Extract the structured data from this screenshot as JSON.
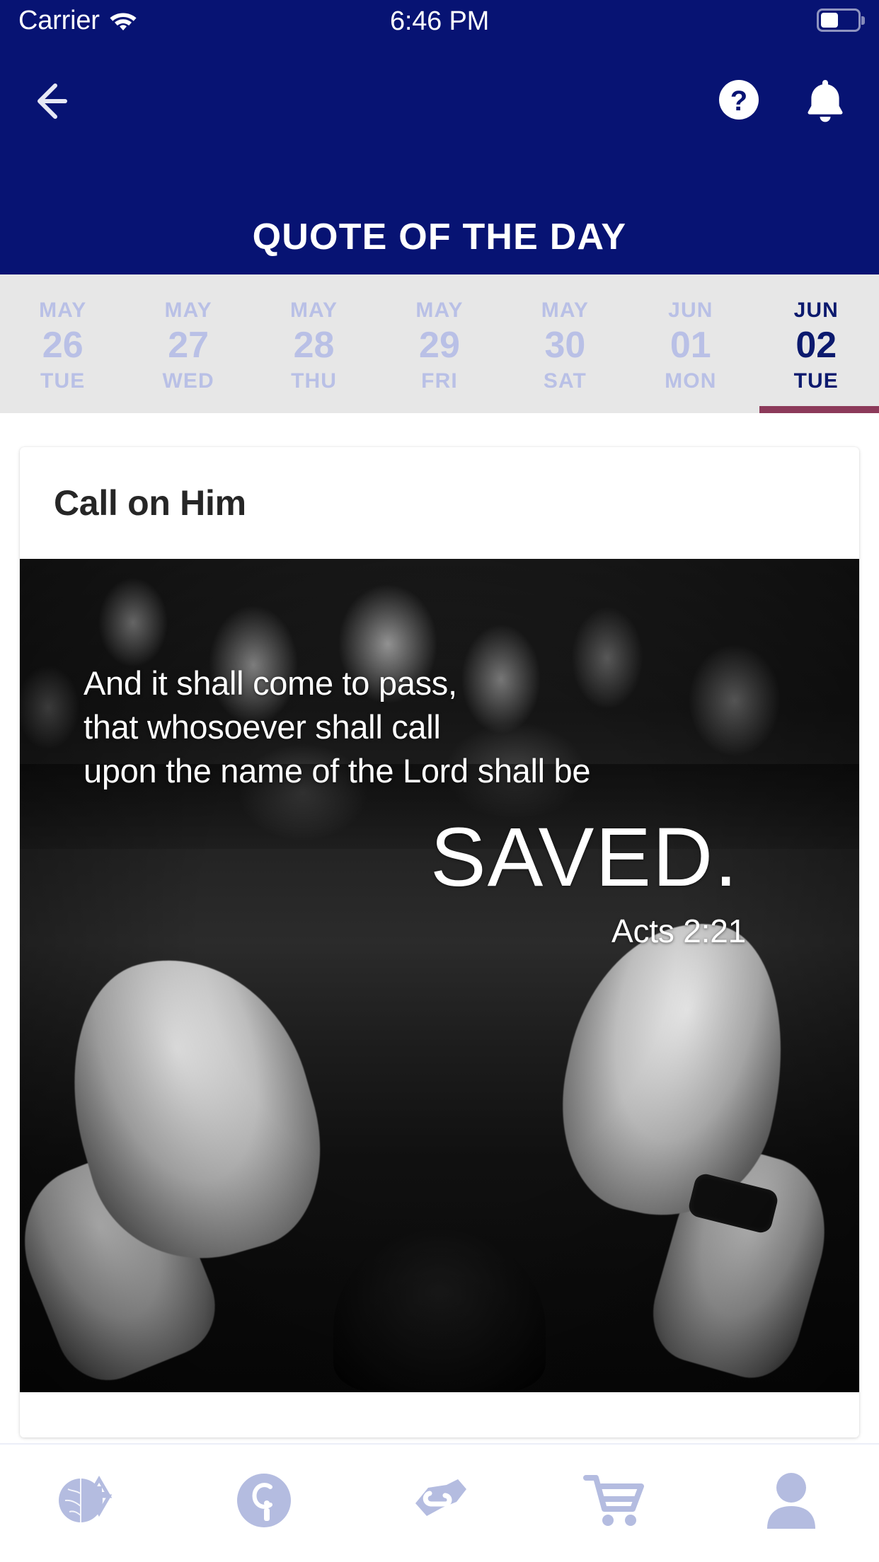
{
  "status_bar": {
    "carrier": "Carrier",
    "wifi_icon": "wifi-icon",
    "time": "6:46 PM",
    "battery_icon": "battery-icon",
    "battery_level_pct": 45
  },
  "nav_bar": {
    "back_icon": "back-arrow-icon",
    "help_icon": "help-circle-icon",
    "notifications_icon": "bell-icon",
    "title": "QUOTE OF THE DAY",
    "background_color": "#071373"
  },
  "date_strip": {
    "background_color": "#e7e7e7",
    "inactive_color": "#b9c0e6",
    "active_color": "#0c1a6e",
    "active_underline_color": "#8c3a5a",
    "days": [
      {
        "month": "MAY",
        "day": "26",
        "weekday": "TUE",
        "selected": false
      },
      {
        "month": "MAY",
        "day": "27",
        "weekday": "WED",
        "selected": false
      },
      {
        "month": "MAY",
        "day": "28",
        "weekday": "THU",
        "selected": false
      },
      {
        "month": "MAY",
        "day": "29",
        "weekday": "FRI",
        "selected": false
      },
      {
        "month": "MAY",
        "day": "30",
        "weekday": "SAT",
        "selected": false
      },
      {
        "month": "JUN",
        "day": "01",
        "weekday": "MON",
        "selected": false
      },
      {
        "month": "JUN",
        "day": "02",
        "weekday": "TUE",
        "selected": true
      }
    ]
  },
  "card": {
    "title": "Call on Him",
    "quote": {
      "lines": [
        "And it shall come to pass,",
        "that whosoever shall call",
        "upon the name of the Lord shall be"
      ],
      "emphasis": "SAVED.",
      "reference": "Acts 2:21"
    },
    "image_alt": "black-and-white photo of raised open hands in a worship crowd"
  },
  "tab_bar": {
    "items": [
      {
        "icon": "globe-star-cross-icon",
        "name": "ministry-home"
      },
      {
        "icon": "info-circle-icon",
        "name": "info"
      },
      {
        "icon": "giving-hand-icon",
        "name": "give"
      },
      {
        "icon": "shopping-cart-icon",
        "name": "store"
      },
      {
        "icon": "person-icon",
        "name": "profile"
      }
    ],
    "icon_color": "#b4bce0"
  }
}
